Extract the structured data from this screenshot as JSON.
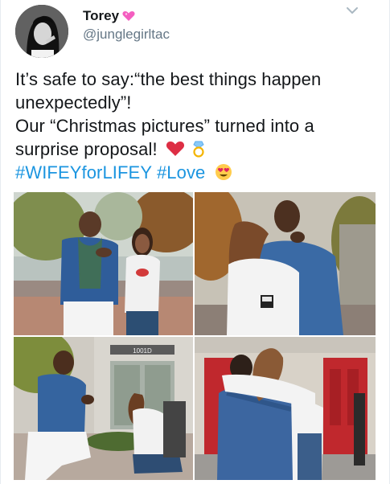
{
  "user": {
    "display_name": "Torey",
    "handle": "@junglegirltac",
    "name_emoji_icon": "pink-heart-icon",
    "avatar_icon": "profile-photo"
  },
  "menu": {
    "icon": "chevron-down-icon"
  },
  "tweet": {
    "line1": "It’s safe to say:“the best things happen",
    "line2": "unexpectedly”!",
    "line3": "Our “Christmas pictures” turned into a",
    "line4": "surprise proposal!",
    "line4_emojis": [
      "red-heart-icon",
      "ring-icon"
    ],
    "hashtag1": "#WIFEYforLIFEY",
    "hashtag2": "#Love",
    "line5_emoji": "heart-eyes-icon"
  },
  "photos": [
    {
      "name": "photo-proposal-1",
      "content": "man showing ring, woman surprised"
    },
    {
      "name": "photo-proposal-2",
      "content": "couple hugging, ring box"
    },
    {
      "name": "photo-proposal-3",
      "content": "man kneeling, woman kneeling"
    },
    {
      "name": "photo-proposal-4",
      "content": "couple embracing at red doors"
    }
  ],
  "signs": {
    "store_number": "1001D"
  },
  "colors": {
    "hashtag": "#1b95e0",
    "name": "#14171a",
    "handle": "#657786"
  }
}
